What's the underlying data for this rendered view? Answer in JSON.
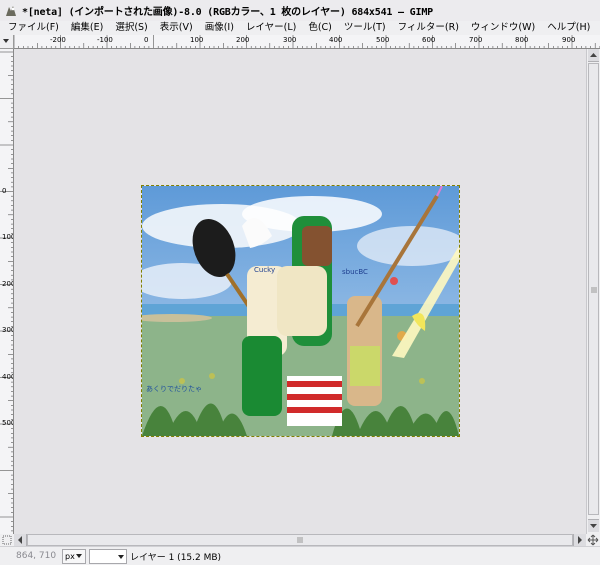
{
  "window": {
    "title": "*[neta] (インポートされた画像)-8.0 (RGBカラー、1 枚のレイヤー) 684x541 – GIMP"
  },
  "menu": [
    "ファイル(F)",
    "編集(E)",
    "選択(S)",
    "表示(V)",
    "画像(I)",
    "レイヤー(L)",
    "色(C)",
    "ツール(T)",
    "フィルター(R)",
    "ウィンドウ(W)",
    "ヘルプ(H)"
  ],
  "ruler": {
    "h_labels": [
      "-200",
      "-100",
      "0",
      "100",
      "200",
      "300",
      "400",
      "500",
      "600",
      "700",
      "800",
      "900"
    ],
    "v_labels": [
      "0",
      "100",
      "200",
      "300",
      "400",
      "500"
    ]
  },
  "canvas": {
    "username_tag": "Cucky",
    "name_tag": "sbucBC",
    "chat_text": "あくりでだりたゃ"
  },
  "status": {
    "pointer_coords": "864, 710",
    "unit": "px",
    "zoom": "",
    "layer_info": "レイヤー 1 (15.2 MB)"
  },
  "colors": {
    "chrome": "#efeff1",
    "canvas_bg": "#e4e3e6",
    "sky": "#7fb0df",
    "grass": "#7fa97a"
  }
}
